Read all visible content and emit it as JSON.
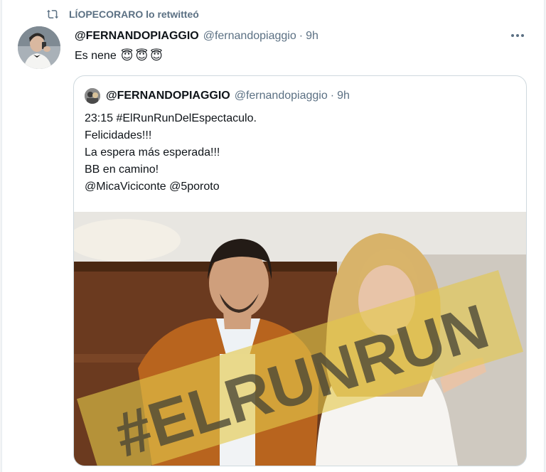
{
  "retweet": {
    "icon": "retweet-icon",
    "text": "LÍOPECORARO lo retwitteó"
  },
  "tweet": {
    "author_name": "@FERNANDOPIAGGIO",
    "author_handle": "@fernandopiaggio",
    "separator": "·",
    "time": "9h",
    "text": "Es nene",
    "emojis": "😇😇😇",
    "more_icon": "more-options-icon"
  },
  "quote": {
    "author_name": "@FERNANDOPIAGGIO",
    "author_handle": "@fernandopiaggio",
    "separator": "·",
    "time": "9h",
    "lines": [
      "23:15 #ElRunRunDelEspectaculo.",
      "Felicidades!!!",
      "La espera más esperada!!!",
      "BB en camino!",
      "@MicaViciconte @5poroto"
    ],
    "image_overlay_text": "#ELRUNRUN"
  },
  "colors": {
    "text": "#0f1419",
    "secondary": "#5b7083",
    "border": "#cfd9de",
    "stamp": "#e3c84a"
  }
}
